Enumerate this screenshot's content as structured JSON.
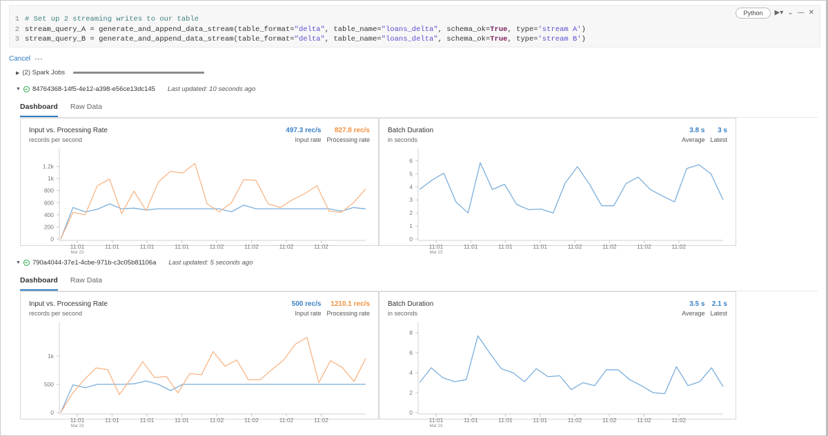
{
  "cell": {
    "language": "Python",
    "code_lines": [
      {
        "num": "1",
        "tokens": [
          {
            "t": "# Set up 2 streaming writes to our table",
            "c": "comment"
          }
        ]
      },
      {
        "num": "2",
        "tokens": [
          {
            "t": "stream_query_A = generate_and_append_data_stream(table_format=",
            "c": ""
          },
          {
            "t": "\"delta\"",
            "c": "str"
          },
          {
            "t": ", table_name=",
            "c": ""
          },
          {
            "t": "\"loans_delta\"",
            "c": "str"
          },
          {
            "t": ", schema_ok=",
            "c": ""
          },
          {
            "t": "True",
            "c": "kw"
          },
          {
            "t": ", type=",
            "c": ""
          },
          {
            "t": "'stream A'",
            "c": "str"
          },
          {
            "t": ")",
            "c": ""
          }
        ]
      },
      {
        "num": "3",
        "tokens": [
          {
            "t": "stream_query_B = generate_and_append_data_stream(table_format=",
            "c": ""
          },
          {
            "t": "\"delta\"",
            "c": "str"
          },
          {
            "t": ", table_name=",
            "c": ""
          },
          {
            "t": "\"loans_delta\"",
            "c": "str"
          },
          {
            "t": ", schema_ok=",
            "c": ""
          },
          {
            "t": "True",
            "c": "kw"
          },
          {
            "t": ", type=",
            "c": ""
          },
          {
            "t": "'stream B'",
            "c": "str"
          },
          {
            "t": ")",
            "c": ""
          }
        ]
      }
    ],
    "toolbar_icons": [
      "run-icon",
      "chevron-down-icon",
      "minimize-icon",
      "close-icon"
    ]
  },
  "run": {
    "cancel_label": "Cancel",
    "spark_jobs_label": "(2) Spark Jobs"
  },
  "colors": {
    "input": "#3a80c5",
    "processing": "#f4913f",
    "input_line": "#7aaedb",
    "processing_line": "#f7b585",
    "accent": "#2b78c2",
    "status_ok": "#27a745"
  },
  "streams": [
    {
      "id": "84764368-14f5-4e12-a398-e56ce13dc145",
      "last_updated": "Last updated: 10 seconds ago",
      "tabs": [
        "Dashboard",
        "Raw Data"
      ],
      "active_tab": 0,
      "rate_panel": {
        "title": "Input vs. Processing Rate",
        "subtitle": "records per second",
        "input_value": "497.3 rec/s",
        "input_label": "Input rate",
        "processing_value": "827.8 rec/s",
        "processing_label": "Processing rate"
      },
      "duration_panel": {
        "title": "Batch Duration",
        "subtitle": "in seconds",
        "average_value": "3.8 s",
        "average_label": "Average",
        "latest_value": "3 s",
        "latest_label": "Latest"
      }
    },
    {
      "id": "790a4044-37e1-4cbe-971b-c3c05b81106a",
      "last_updated": "Last updated: 5 seconds ago",
      "tabs": [
        "Dashboard",
        "Raw Data"
      ],
      "active_tab": 0,
      "rate_panel": {
        "title": "Input vs. Processing Rate",
        "subtitle": "records per second",
        "input_value": "500 rec/s",
        "input_label": "Input rate",
        "processing_value": "1210.1 rec/s",
        "processing_label": "Processing rate"
      },
      "duration_panel": {
        "title": "Batch Duration",
        "subtitle": "in seconds",
        "average_value": "3.5 s",
        "average_label": "Average",
        "latest_value": "2.1 s",
        "latest_label": "Latest"
      }
    }
  ],
  "chart_data": [
    {
      "type": "line",
      "title": "Input vs. Processing Rate",
      "ylabel": "records per second",
      "ylim": [
        0,
        1400
      ],
      "yticks": [
        0,
        200,
        400,
        600,
        800,
        1000,
        1200
      ],
      "ytick_labels": [
        "0",
        "200",
        "400",
        "600",
        "800",
        "1k",
        "1.2k"
      ],
      "xtick_labels": [
        "11:01",
        "11:01",
        "11:01",
        "11:01",
        "11:02",
        "11:02",
        "11:02",
        "11:02"
      ],
      "xtick_sublabel": "Mar 23",
      "series": [
        {
          "name": "Input rate",
          "values": [
            0,
            520,
            450,
            490,
            580,
            500,
            510,
            480,
            500,
            500,
            500,
            500,
            500,
            500,
            450,
            560,
            500,
            500,
            500,
            500,
            500,
            500,
            500,
            460,
            520,
            497
          ]
        },
        {
          "name": "Processing rate",
          "values": [
            0,
            440,
            400,
            880,
            990,
            420,
            790,
            470,
            940,
            1120,
            1090,
            1250,
            580,
            450,
            600,
            980,
            970,
            580,
            520,
            650,
            750,
            880,
            460,
            440,
            600,
            828
          ]
        }
      ]
    },
    {
      "type": "line",
      "title": "Batch Duration",
      "ylabel": "in seconds",
      "ylim": [
        0,
        6.5
      ],
      "yticks": [
        0,
        1,
        2,
        3,
        4,
        5,
        6
      ],
      "ytick_labels": [
        "0",
        "1",
        "2",
        "3",
        "4",
        "5",
        "6"
      ],
      "xtick_labels": [
        "11:01",
        "11:01",
        "11:01",
        "11:01",
        "11:02",
        "11:02",
        "11:02",
        "11:02"
      ],
      "xtick_sublabel": "Mar 23",
      "series": [
        {
          "name": "Batch duration",
          "values": [
            3.8,
            4.5,
            5.05,
            2.85,
            2.0,
            5.85,
            3.8,
            4.2,
            2.65,
            2.25,
            2.3,
            2.0,
            4.3,
            5.55,
            4.2,
            2.55,
            2.55,
            4.25,
            4.75,
            3.8,
            3.3,
            2.85,
            5.4,
            5.7,
            5.0,
            3.0
          ]
        }
      ]
    },
    {
      "type": "line",
      "title": "Input vs. Processing Rate",
      "ylabel": "records per second",
      "ylim": [
        0,
        1500
      ],
      "yticks": [
        0,
        500,
        1000
      ],
      "ytick_labels": [
        "0",
        "500",
        "1k"
      ],
      "xtick_labels": [
        "11:01",
        "11:01",
        "11:01",
        "11:01",
        "11:02",
        "11:02",
        "11:02",
        "11:02"
      ],
      "xtick_sublabel": "Mar 23",
      "series": [
        {
          "name": "Input rate",
          "values": [
            0,
            490,
            440,
            500,
            500,
            500,
            510,
            560,
            500,
            390,
            500,
            500,
            500,
            500,
            500,
            500,
            500,
            500,
            500,
            500,
            500,
            500,
            500,
            500,
            500,
            500
          ]
        },
        {
          "name": "Processing rate",
          "values": [
            0,
            340,
            580,
            790,
            760,
            320,
            600,
            900,
            620,
            640,
            350,
            690,
            670,
            1080,
            820,
            930,
            580,
            580,
            760,
            930,
            1210,
            1330,
            530,
            920,
            800,
            550,
            960
          ]
        }
      ]
    },
    {
      "type": "line",
      "title": "Batch Duration",
      "ylabel": "in seconds",
      "ylim": [
        0,
        8.5
      ],
      "yticks": [
        0,
        2,
        4,
        6,
        8
      ],
      "ytick_labels": [
        "0",
        "2",
        "4",
        "6",
        "8"
      ],
      "xtick_labels": [
        "11:01",
        "11:01",
        "11:01",
        "11:01",
        "11:02",
        "11:02",
        "11:02",
        "11:02"
      ],
      "xtick_sublabel": "Mar 23",
      "series": [
        {
          "name": "Batch duration",
          "values": [
            3.0,
            4.5,
            3.5,
            3.1,
            3.3,
            7.7,
            6.0,
            4.4,
            4.0,
            3.1,
            4.4,
            3.6,
            3.7,
            2.3,
            3.0,
            2.7,
            4.3,
            4.3,
            3.3,
            2.7,
            2.0,
            1.9,
            4.6,
            2.7,
            3.1,
            4.5,
            2.6
          ]
        }
      ]
    }
  ]
}
